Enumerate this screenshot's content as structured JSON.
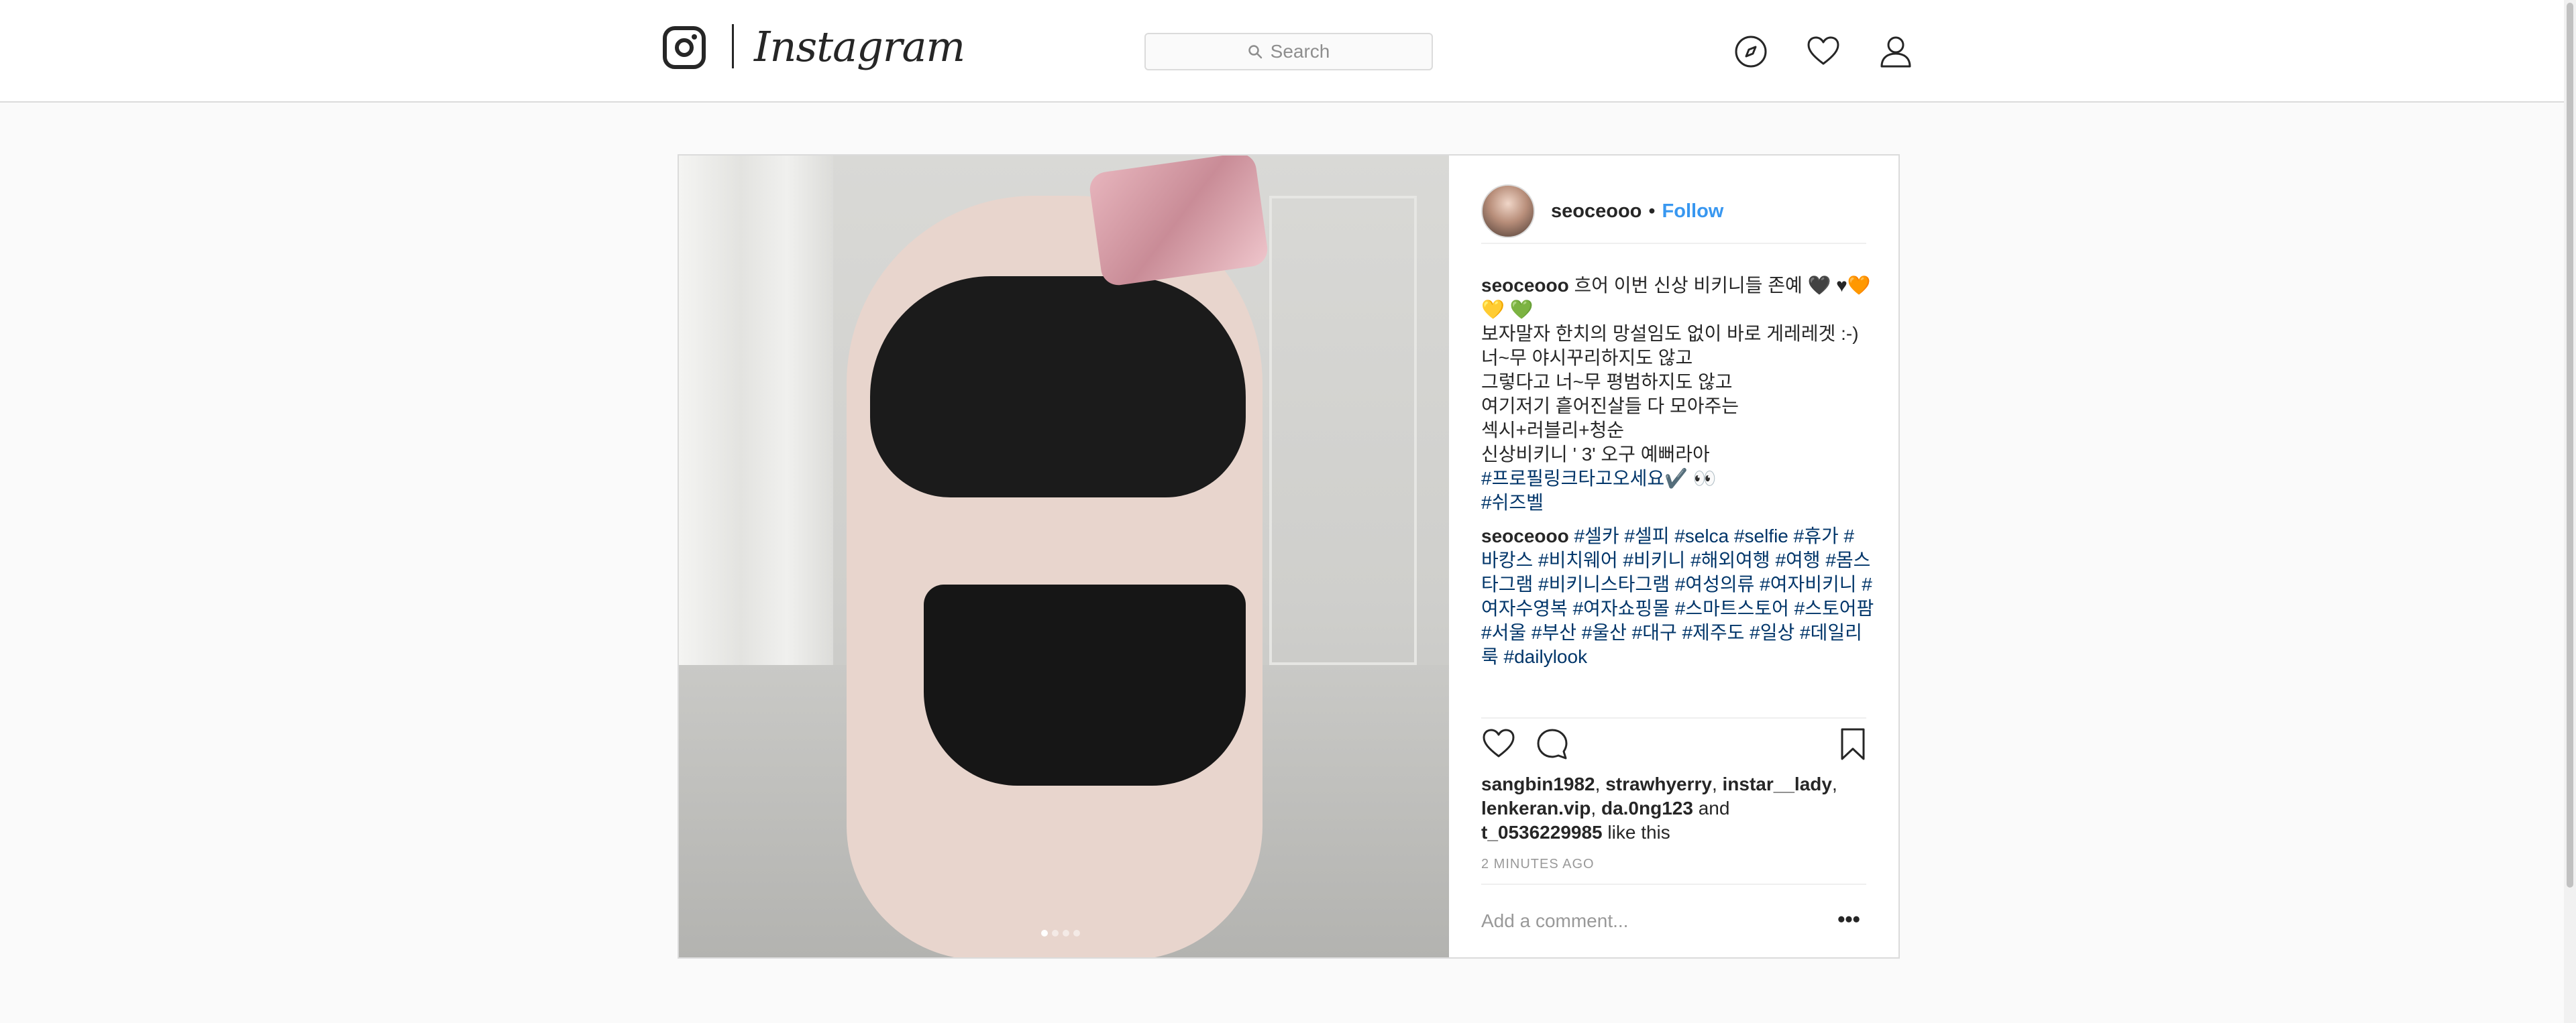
{
  "header": {
    "wordmark": "Instagram",
    "search_placeholder": "Search",
    "icons": [
      "instagram-logo-icon",
      "search-icon",
      "compass-icon",
      "heart-icon",
      "user-icon"
    ]
  },
  "post": {
    "author": "seoceooo",
    "separator": "•",
    "follow_label": "Follow",
    "carousel_count": 4,
    "carousel_active": 1,
    "caption": {
      "username": "seoceooo",
      "line1": "흐어 이번 신상 비키니들 존예 🖤 ♥🧡",
      "line2": "💛 💚",
      "line3": "보자말자 한치의 망설임도 없이 바로 게레레겟 :-)",
      "line4": "너~무 야시꾸리하지도 않고",
      "line5": "그렇다고 너~무 평범하지도 않고",
      "line6": "여기저기 흩어진살들 다 모아주는",
      "line7": "섹시+러블리+청순",
      "line8": "신상비키니 ' 3' 오구 예뻐라아",
      "tag1": "#프로필링크타고오세요✔️ 👀",
      "tag2": "#쉬즈벨"
    },
    "hashtag_comment": {
      "username": "seoceooo",
      "line1": "#셀카 #셀피 #selca #selfie #휴가 #",
      "line2": "바캉스 #비치웨어 #비키니 #해외여행 #여행 #몸스",
      "line3": "타그램 #비키니스타그램 #여성의류 #여자비키니 #",
      "line4": "여자수영복 #여자쇼핑몰 #스마트스토어 #스토어팜",
      "line5": "#서울 #부산 #울산 #대구 #제주도 #일상 #데일리",
      "line6": "룩 #dailylook"
    },
    "likes": {
      "user1": "sangbin1982",
      "user2": "strawhyerry",
      "user3": "instar__lady",
      "user4": "lenkeran.vip",
      "user5": "da.0ng123",
      "user6": "t_0536229985",
      "comma": ",",
      "and": "and",
      "like_this": "like this"
    },
    "timestamp": "2 MINUTES AGO",
    "comment_placeholder": "Add a comment...",
    "more_label": "•••"
  }
}
